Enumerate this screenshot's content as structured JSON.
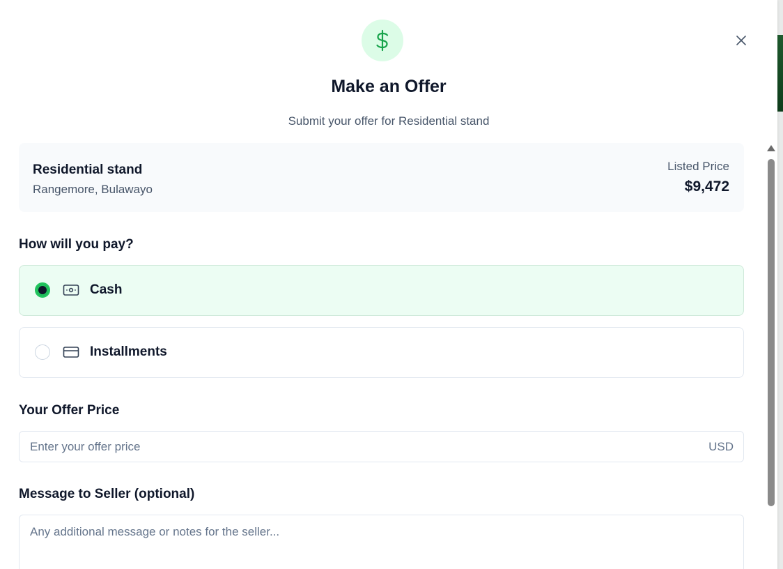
{
  "modal": {
    "title": "Make an Offer",
    "subtitle": "Submit your offer for Residential stand",
    "close_icon": "close-icon",
    "header_icon": "dollar-icon"
  },
  "property": {
    "name": "Residential stand",
    "location": "Rangemore, Bulawayo",
    "price_label": "Listed Price",
    "price_value": "$9,472"
  },
  "payment": {
    "label": "How will you pay?",
    "options": [
      {
        "label": "Cash",
        "icon": "cash-icon",
        "selected": true
      },
      {
        "label": "Installments",
        "icon": "credit-card-icon",
        "selected": false
      }
    ]
  },
  "offer_price": {
    "label": "Your Offer Price",
    "placeholder": "Enter your offer price",
    "value": "",
    "currency": "USD"
  },
  "message": {
    "label": "Message to Seller (optional)",
    "placeholder": "Any additional message or notes for the seller...",
    "value": ""
  },
  "colors": {
    "accent": "#22c55e",
    "accent_light": "#dcfce7",
    "selected_bg": "#ecfdf3"
  }
}
